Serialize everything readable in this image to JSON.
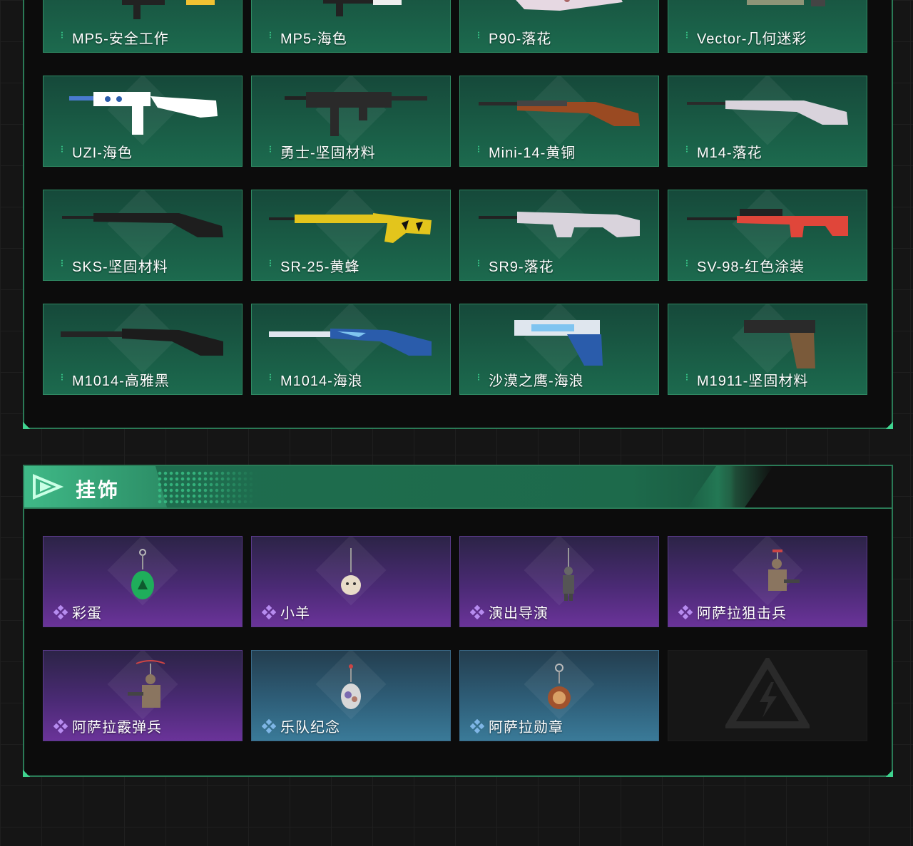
{
  "weapons": {
    "items": [
      {
        "label": "MP5-安全工作",
        "icon": "smg-icon",
        "accent": "#f1c232"
      },
      {
        "label": "MP5-海色",
        "icon": "smg-icon",
        "accent": "#e8e8e8"
      },
      {
        "label": "P90-落花",
        "icon": "smg-icon",
        "accent": "#e6d8e2"
      },
      {
        "label": "Vector-几何迷彩",
        "icon": "smg-icon",
        "accent": "#8e9477"
      },
      {
        "label": "UZI-海色",
        "icon": "smg-icon",
        "accent": "#ffffff"
      },
      {
        "label": "勇士-坚固材料",
        "icon": "smg-icon",
        "accent": "#2a2a2a"
      },
      {
        "label": "Mini-14-黄铜",
        "icon": "rifle-icon",
        "accent": "#9a4a22"
      },
      {
        "label": "M14-落花",
        "icon": "rifle-icon",
        "accent": "#d9d3dc"
      },
      {
        "label": "SKS-坚固材料",
        "icon": "rifle-icon",
        "accent": "#2a2a2a"
      },
      {
        "label": "SR-25-黄蜂",
        "icon": "rifle-icon",
        "accent": "#e3c51c"
      },
      {
        "label": "SR9-落花",
        "icon": "rifle-icon",
        "accent": "#d9d3dc"
      },
      {
        "label": "SV-98-红色涂装",
        "icon": "sniper-icon",
        "accent": "#e0463a"
      },
      {
        "label": "M1014-高雅黑",
        "icon": "shotgun-icon",
        "accent": "#242424"
      },
      {
        "label": "M1014-海浪",
        "icon": "shotgun-icon",
        "accent": "#2a5cab"
      },
      {
        "label": "沙漠之鹰-海浪",
        "icon": "pistol-icon",
        "accent": "#2a5cab"
      },
      {
        "label": "M1911-坚固材料",
        "icon": "pistol-icon",
        "accent": "#2a2a2a"
      }
    ]
  },
  "pendants": {
    "title": "挂饰",
    "items": [
      {
        "label": "彩蛋",
        "rarity": "purple",
        "icon": "egg-pendant-icon",
        "accent": "#1fae5b"
      },
      {
        "label": "小羊",
        "rarity": "purple",
        "icon": "sheep-pendant-icon",
        "accent": "#e8dcc8"
      },
      {
        "label": "演出导演",
        "rarity": "purple",
        "icon": "figure-pendant-icon",
        "accent": "#555555"
      },
      {
        "label": "阿萨拉狙击兵",
        "rarity": "purple",
        "icon": "soldier-pendant-icon",
        "accent": "#8a7560"
      },
      {
        "label": "阿萨拉霰弹兵",
        "rarity": "purple",
        "icon": "soldier-pendant-icon",
        "accent": "#8a7560"
      },
      {
        "label": "乐队纪念",
        "rarity": "blue",
        "icon": "badge-pendant-icon",
        "accent": "#c8c8c8"
      },
      {
        "label": "阿萨拉勋章",
        "rarity": "blue",
        "icon": "medal-pendant-icon",
        "accent": "#a0522d"
      }
    ]
  },
  "colors": {
    "frame": "#2a7a56",
    "green_card": "#1c6a4e",
    "purple_card": "#6a3399",
    "blue_card": "#3a7a98"
  }
}
